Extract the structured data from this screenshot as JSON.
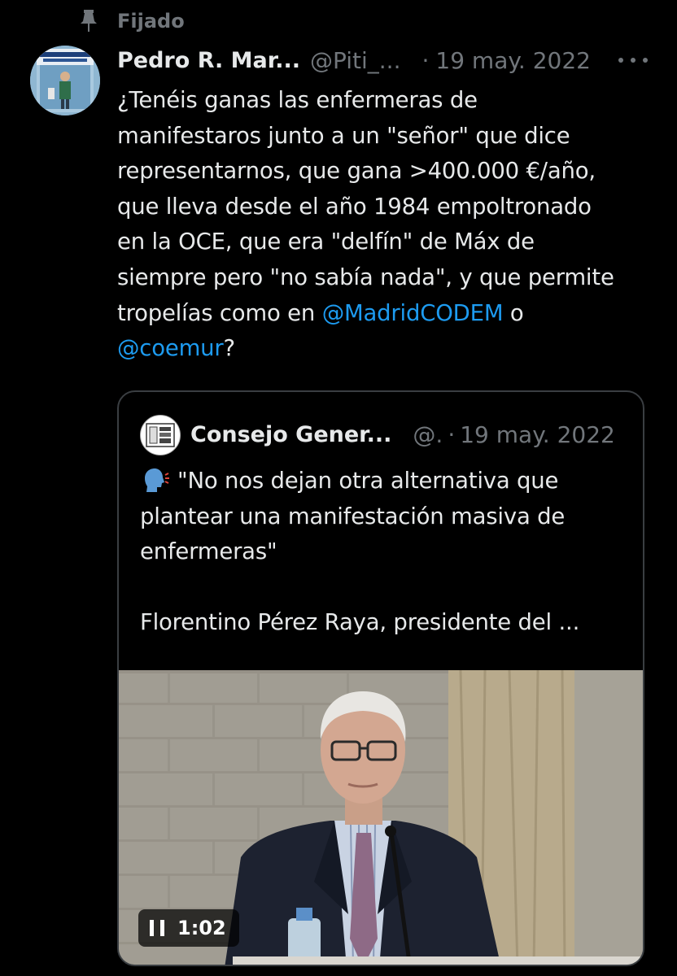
{
  "pinned": {
    "label": "Fijado",
    "icon": "pin-icon"
  },
  "post": {
    "author_name": "Pedro R. Mar...",
    "author_handle": "@Piti_...",
    "separator": "·",
    "date": "19 may. 2022",
    "more_icon": "more-horizontal-icon",
    "text_lines": [
      "¿Tenéis ganas las enfermeras de",
      "manifestaros junto a un \"señor\" que dice",
      "representarnos, que gana >400.000 €/año,",
      "que lleva desde el año 1984 empoltronado",
      "en la OCE, que era \"delfín\" de Máx de",
      "siempre pero \"no sabía nada\", y que permite"
    ],
    "text_line7_prefix": "tropelías como en ",
    "mention_1": "@MadridCODEM",
    "text_line7_suffix": " o",
    "mention_2": "@coemur",
    "text_line8_suffix": "?"
  },
  "quoted": {
    "author_name": "Consejo Gener...",
    "author_handle": "@.",
    "separator": "·",
    "date": "19 may. 2022",
    "emoji_icon": "speaking-head-icon",
    "text_lines": [
      "\"No nos dejan otra alternativa que",
      "plantear una manifestación masiva de",
      "enfermeras\""
    ],
    "text_last": "Florentino Pérez Raya, presidente del ...",
    "video": {
      "time": "1:02",
      "state_icon": "pause-icon"
    }
  },
  "colors": {
    "background": "#000000",
    "text": "#e7e9ea",
    "muted": "#71767b",
    "link": "#1d9bf0",
    "border": "#3a3e42"
  }
}
